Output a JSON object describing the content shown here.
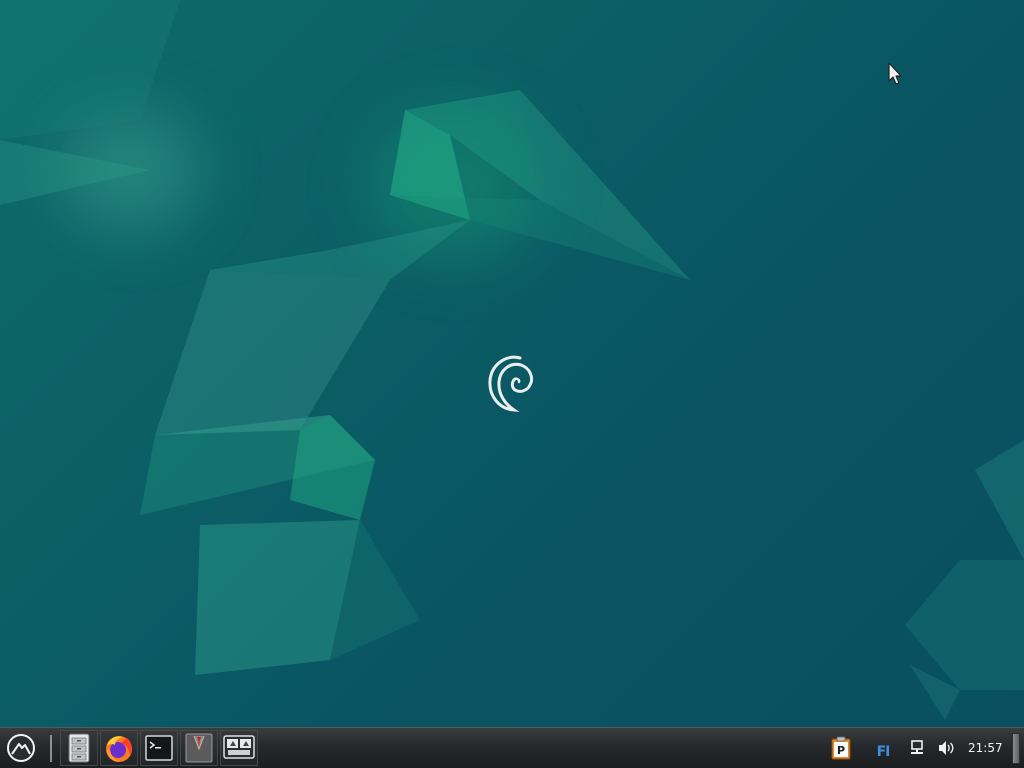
{
  "desktop": {
    "wallpaper": "debian-wallpaper",
    "logo_icon": "debian-swirl-icon",
    "colors": {
      "background": "#0a5563",
      "accent": "#1fa58a"
    }
  },
  "taskbar": {
    "menu_icon": "start-menu-icon",
    "launchers": [
      {
        "icon": "file-manager-icon"
      },
      {
        "icon": "firefox-icon"
      },
      {
        "icon": "terminal-icon"
      },
      {
        "icon": "text-editor-icon"
      },
      {
        "icon": "remote-desktop-icon"
      }
    ],
    "tray": {
      "clipboard_icon": "clipboard-icon",
      "keyboard_layout": "FI",
      "network_icon": "network-icon",
      "volume_icon": "volume-icon",
      "clock": "21:57",
      "show_desktop_icon": "show-desktop-icon"
    }
  }
}
